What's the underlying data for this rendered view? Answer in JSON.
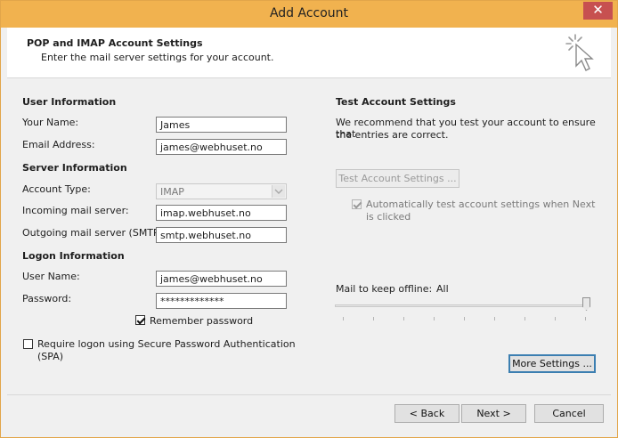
{
  "window": {
    "title": "Add Account",
    "close_label": "✕"
  },
  "header": {
    "title": "POP and IMAP Account Settings",
    "subtitle": "Enter the mail server settings for your account."
  },
  "user_info": {
    "section_title": "User Information",
    "name_label": "Your Name:",
    "name_value": "James",
    "email_label": "Email Address:",
    "email_value": "james@webhuset.no"
  },
  "server_info": {
    "section_title": "Server Information",
    "account_type_label": "Account Type:",
    "account_type_value": "IMAP",
    "incoming_label": "Incoming mail server:",
    "incoming_value": "imap.webhuset.no",
    "outgoing_label": "Outgoing mail server (SMTP):",
    "outgoing_value": "smtp.webhuset.no"
  },
  "logon_info": {
    "section_title": "Logon Information",
    "username_label": "User Name:",
    "username_value": "james@webhuset.no",
    "password_label": "Password:",
    "password_value": "*************",
    "remember_label": "Remember password",
    "remember_checked": true,
    "spa_label": "Require logon using Secure Password Authentication",
    "spa_label_2": "(SPA)",
    "spa_checked": false
  },
  "test": {
    "section_title": "Test Account Settings",
    "description_1": "We recommend that you test your account to ensure that",
    "description_2": "the entries are correct.",
    "button_label": "Test Account Settings ...",
    "auto_test_label_1": "Automatically test account settings when Next",
    "auto_test_label_2": "is clicked",
    "auto_test_checked": true
  },
  "offline": {
    "label": "Mail to keep offline:",
    "value": "All",
    "slider_level": 1.0
  },
  "more_settings_label": "More Settings ...",
  "footer": {
    "back_label": "< Back",
    "next_label": "Next >",
    "cancel_label": "Cancel"
  },
  "colors": {
    "title_bar": "#f1b24f",
    "close_button": "#c75050",
    "focus_border": "#3c7fb1"
  },
  "icons": {
    "header_icon": "cursor-click-icon",
    "close_icon": "close-icon",
    "dropdown_icon": "chevron-down-icon"
  }
}
